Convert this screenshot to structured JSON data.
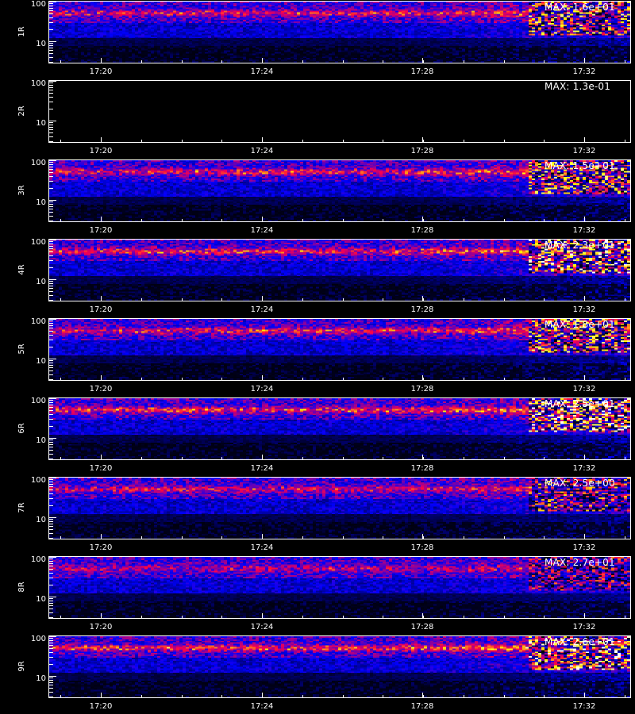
{
  "chart_data": {
    "type": "heatmap",
    "x_ticks": [
      "17:20",
      "17:24",
      "17:28",
      "17:32"
    ],
    "y_ticks": [
      "100",
      "10"
    ],
    "y_scale": "log",
    "panels": [
      {
        "ylabel": "1R",
        "max_label": "MAX: 1.6e+01",
        "max_value": 16,
        "intensity": 0.85,
        "empty": false
      },
      {
        "ylabel": "2R",
        "max_label": "MAX: 1.3e-01",
        "max_value": 0.13,
        "intensity": 0.0,
        "empty": true
      },
      {
        "ylabel": "3R",
        "max_label": "MAX: 1.5e+01",
        "max_value": 15,
        "intensity": 0.85,
        "empty": false
      },
      {
        "ylabel": "4R",
        "max_label": "MAX: 2.3e+01",
        "max_value": 23,
        "intensity": 0.95,
        "empty": false
      },
      {
        "ylabel": "5R",
        "max_label": "MAX: 1.8e+01",
        "max_value": 18,
        "intensity": 0.85,
        "empty": false
      },
      {
        "ylabel": "6R",
        "max_label": "MAX: 2.5e+01",
        "max_value": 25,
        "intensity": 1.0,
        "empty": false
      },
      {
        "ylabel": "7R",
        "max_label": "MAX: 2.5e+00",
        "max_value": 2.5,
        "intensity": 0.7,
        "empty": false
      },
      {
        "ylabel": "8R",
        "max_label": "MAX: 2.7e+01",
        "max_value": 27,
        "intensity": 0.6,
        "empty": false
      },
      {
        "ylabel": "9R",
        "max_label": "MAX: 2.6e+01",
        "max_value": 26,
        "intensity": 1.0,
        "empty": false
      }
    ],
    "colormap": [
      "#000000",
      "#0000ff",
      "#ff0000",
      "#ffff00",
      "#ffffff"
    ],
    "grid": false
  }
}
